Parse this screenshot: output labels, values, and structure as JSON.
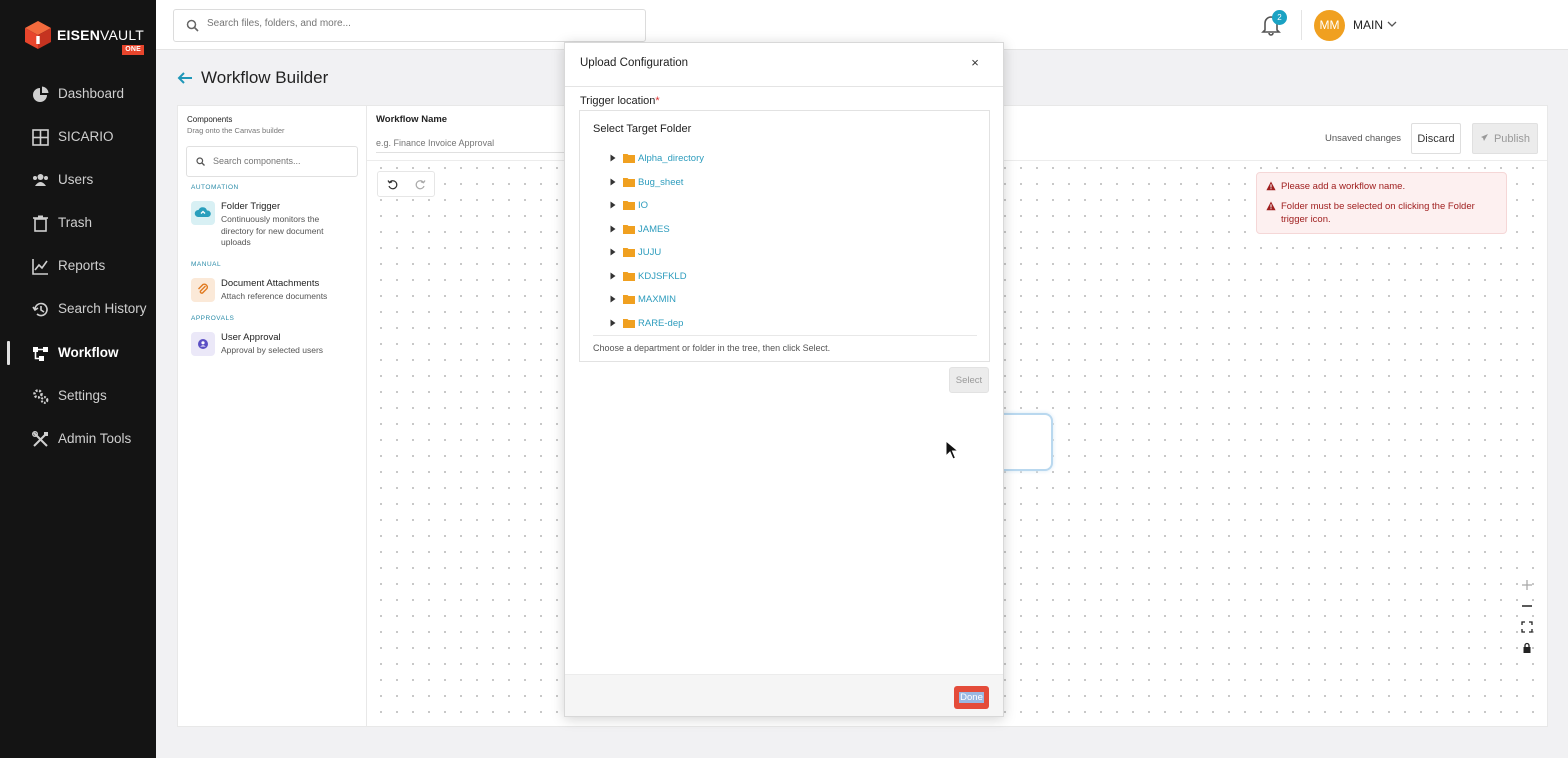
{
  "app": {
    "logo_main": "EISEN",
    "logo_accent": "VAULT",
    "logo_badge": "ONE",
    "brand_color": "#e8452c"
  },
  "sidebar": {
    "items": [
      {
        "label": "Dashboard",
        "icon": "pie-chart-icon"
      },
      {
        "label": "SICARIO",
        "icon": "grid-icon"
      },
      {
        "label": "Users",
        "icon": "users-icon"
      },
      {
        "label": "Trash",
        "icon": "trash-icon"
      },
      {
        "label": "Reports",
        "icon": "line-chart-icon"
      },
      {
        "label": "Search History",
        "icon": "history-icon"
      },
      {
        "label": "Workflow",
        "icon": "workflow-icon"
      },
      {
        "label": "Settings",
        "icon": "gears-icon"
      },
      {
        "label": "Admin Tools",
        "icon": "tools-icon"
      }
    ],
    "active": "Workflow"
  },
  "topbar": {
    "search_placeholder": "Search files, folders, and more...",
    "notification_count": "2",
    "avatar_initials": "MM",
    "user_name": "MAIN"
  },
  "page": {
    "title": "Workflow Builder"
  },
  "components_panel": {
    "title": "Components",
    "subtitle": "Drag onto the Canvas builder",
    "search_placeholder": "Search components...",
    "sections": {
      "automation": "AUTOMATION",
      "manual": "MANUAL",
      "approvals": "APPROVALS"
    },
    "items": {
      "folder_trigger": {
        "title": "Folder Trigger",
        "desc": "Continuously monitors the directory for new document uploads"
      },
      "document_attachments": {
        "title": "Document Attachments",
        "desc": "Attach reference documents"
      },
      "user_approval": {
        "title": "User Approval",
        "desc": "Approval by selected users"
      }
    }
  },
  "canvas": {
    "workflow_name_label": "Workflow Name",
    "workflow_name_placeholder": "e.g. Finance Invoice Approval",
    "unsaved_text": "Unsaved changes",
    "discard_label": "Discard",
    "publish_label": "Publish",
    "alerts": [
      "Please add a workflow name.",
      "Folder must be selected on clicking the Folder trigger icon."
    ]
  },
  "modal": {
    "title": "Upload Configuration",
    "close_label": "×",
    "trigger_label": "Trigger location",
    "required_mark": "*",
    "tree_title": "Select Target Folder",
    "folders": [
      "Alpha_directory",
      "Bug_sheet",
      "IO",
      "JAMES",
      "JUJU",
      "KDJSFKLD",
      "MAXMIN",
      "RARE-dep"
    ],
    "hint": "Choose a department or folder in the tree, then click Select.",
    "select_label": "Select",
    "done_label": "Done"
  }
}
